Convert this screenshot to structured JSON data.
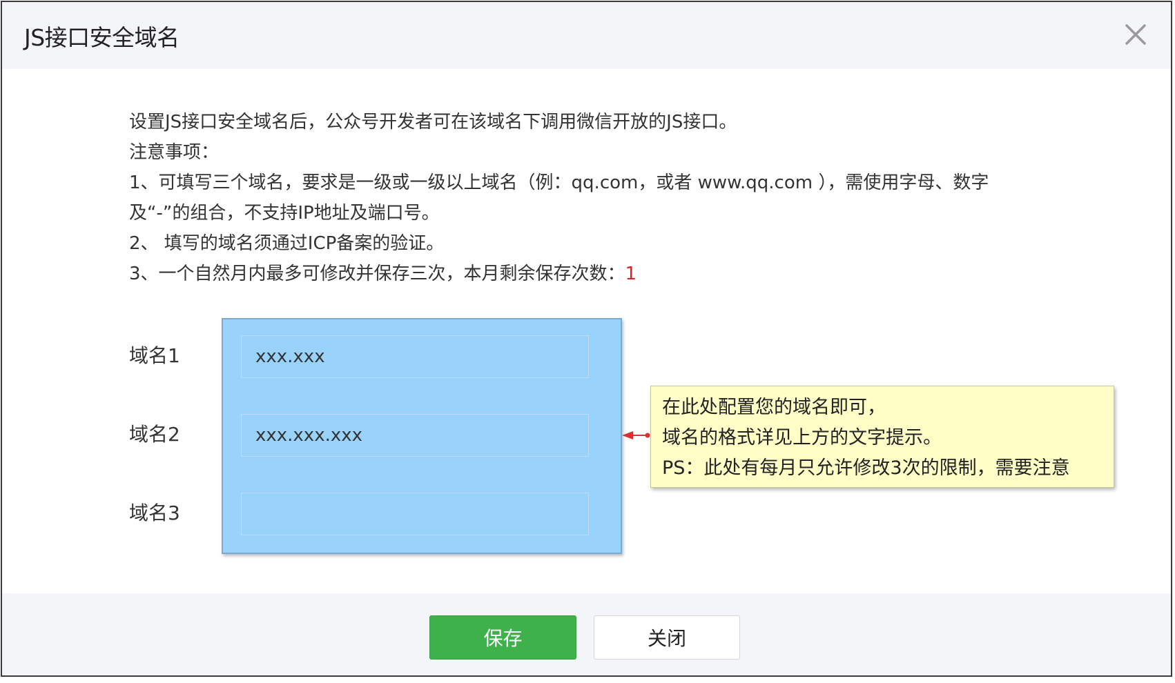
{
  "dialog": {
    "title": "JS接口安全域名"
  },
  "notes": {
    "line1": "设置JS接口安全域名后，公众号开发者可在该域名下调用微信开放的JS接口。",
    "line2": "注意事项：",
    "line3": "1、可填写三个域名，要求是一级或一级以上域名（例：qq.com，或者 www.qq.com ），需使用字母、数字",
    "line4": "及“-”的组合，不支持IP地址及端口号。",
    "line5": "2、 填写的域名须通过ICP备案的验证。",
    "line6_prefix": "3、一个自然月内最多可修改并保存三次，本月剩余保存次数：",
    "remaining_count": "1"
  },
  "fields": [
    {
      "label": "域名1",
      "value": "xxx.xxx",
      "placeholder": ""
    },
    {
      "label": "域名2",
      "value": "xxx.xxx.xxx",
      "placeholder": ""
    },
    {
      "label": "域名3",
      "value": "",
      "placeholder": ""
    }
  ],
  "tooltip": {
    "line1": "在此处配置您的域名即可，",
    "line2": "域名的格式详见上方的文字提示。",
    "line3": "PS：此处有每月只允许修改3次的限制，需要注意"
  },
  "footer": {
    "save_label": "保存",
    "close_label": "关闭"
  },
  "colors": {
    "accent_green": "#3eb14b",
    "highlight_blue": "#99d3fc",
    "tooltip_yellow": "#fefec6",
    "warning_red": "#e02020",
    "header_bg": "#f4f5f9"
  },
  "icons": {
    "close": "close-icon",
    "arrow": "arrow-left-icon"
  }
}
